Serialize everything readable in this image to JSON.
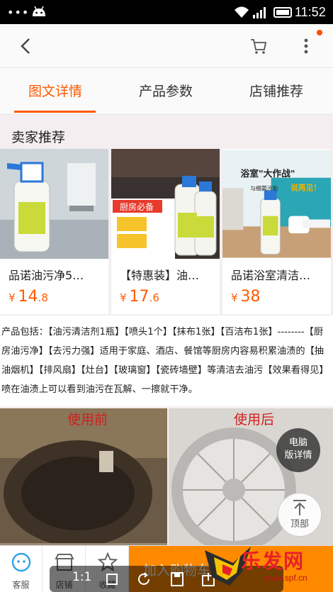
{
  "status_bar": {
    "time": "11:52",
    "dots": "•••"
  },
  "tabs": [
    {
      "label": "图文详情"
    },
    {
      "label": "产品参数"
    },
    {
      "label": "店铺推荐"
    }
  ],
  "section_title": "卖家推荐",
  "products": [
    {
      "name": "品诺油污净5…",
      "price_symbol": "¥",
      "price_int": "14",
      "price_dec": ".8",
      "img_banner": "",
      "img_words": ""
    },
    {
      "name": "【特惠装】油…",
      "price_symbol": "¥",
      "price_int": "17",
      "price_dec": ".6",
      "img_banner": "厨房必备"
    },
    {
      "name": "品诺浴室清洁…",
      "price_symbol": "¥",
      "price_int": "38",
      "price_dec": "",
      "img_banner": "浴室\"大作战\"",
      "img_sub": "与细菌污垢",
      "img_sub2": "说再见！"
    }
  ],
  "description": "产品包括：【油污清洁剂1瓶】【喷头1个】【抹布1张】【百洁布1张】--------【厨房油污净】【去污力强】适用于家庭、酒店、餐馆等厨房内容易积累油渍的【抽油烟机】【排风扇】【灶台】【玻璃窗】【瓷砖墙壁】等清洁去油污【效果看得见】喷在油渍上可以看到油污在瓦解、一擦就干净。",
  "photo_labels": {
    "before": "使用前",
    "after": "使用后"
  },
  "floating": {
    "pc_line1": "电脑",
    "pc_line2": "版详情",
    "top": "顶部"
  },
  "bottom_bar": {
    "service": "客服",
    "shop": "店铺",
    "fav": "收藏",
    "add_cart": "加入购物车"
  },
  "system_overlay": {
    "ratio": "1:1"
  },
  "watermark": {
    "text": "乐发网",
    "url": "www.spf.cn"
  },
  "colors": {
    "accent": "#ff5a00",
    "cart_button": "#ff8a00"
  }
}
